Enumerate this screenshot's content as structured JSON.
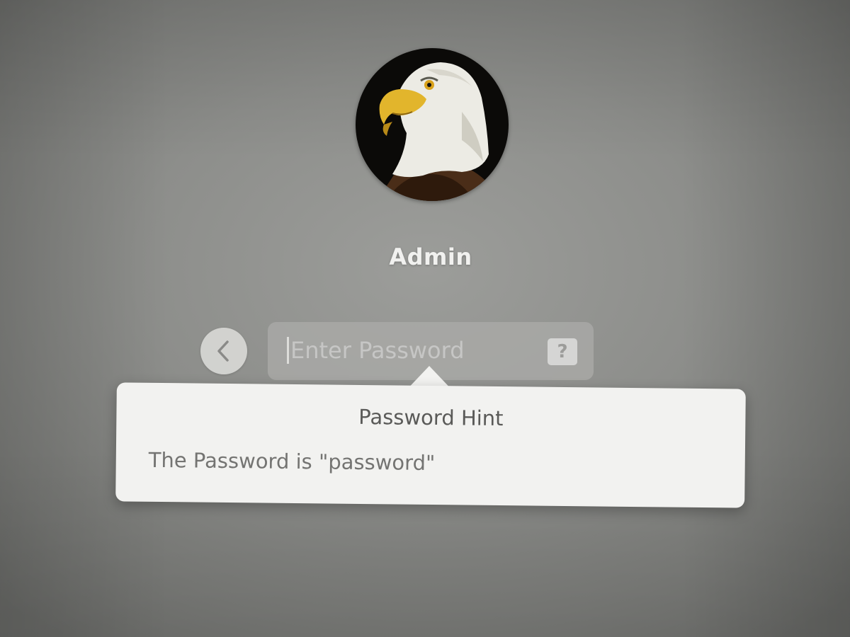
{
  "user": {
    "name": "Admin",
    "avatar_icon": "bald-eagle-avatar"
  },
  "login": {
    "back_icon": "chevron-left-icon",
    "password_placeholder": "Enter Password",
    "hint_button_label": "?"
  },
  "hint": {
    "title": "Password Hint",
    "text": "The Password is \"password\""
  },
  "colors": {
    "background": "#8d8e8b",
    "popover": "#f2f2f0",
    "username": "#f1f1ef"
  }
}
